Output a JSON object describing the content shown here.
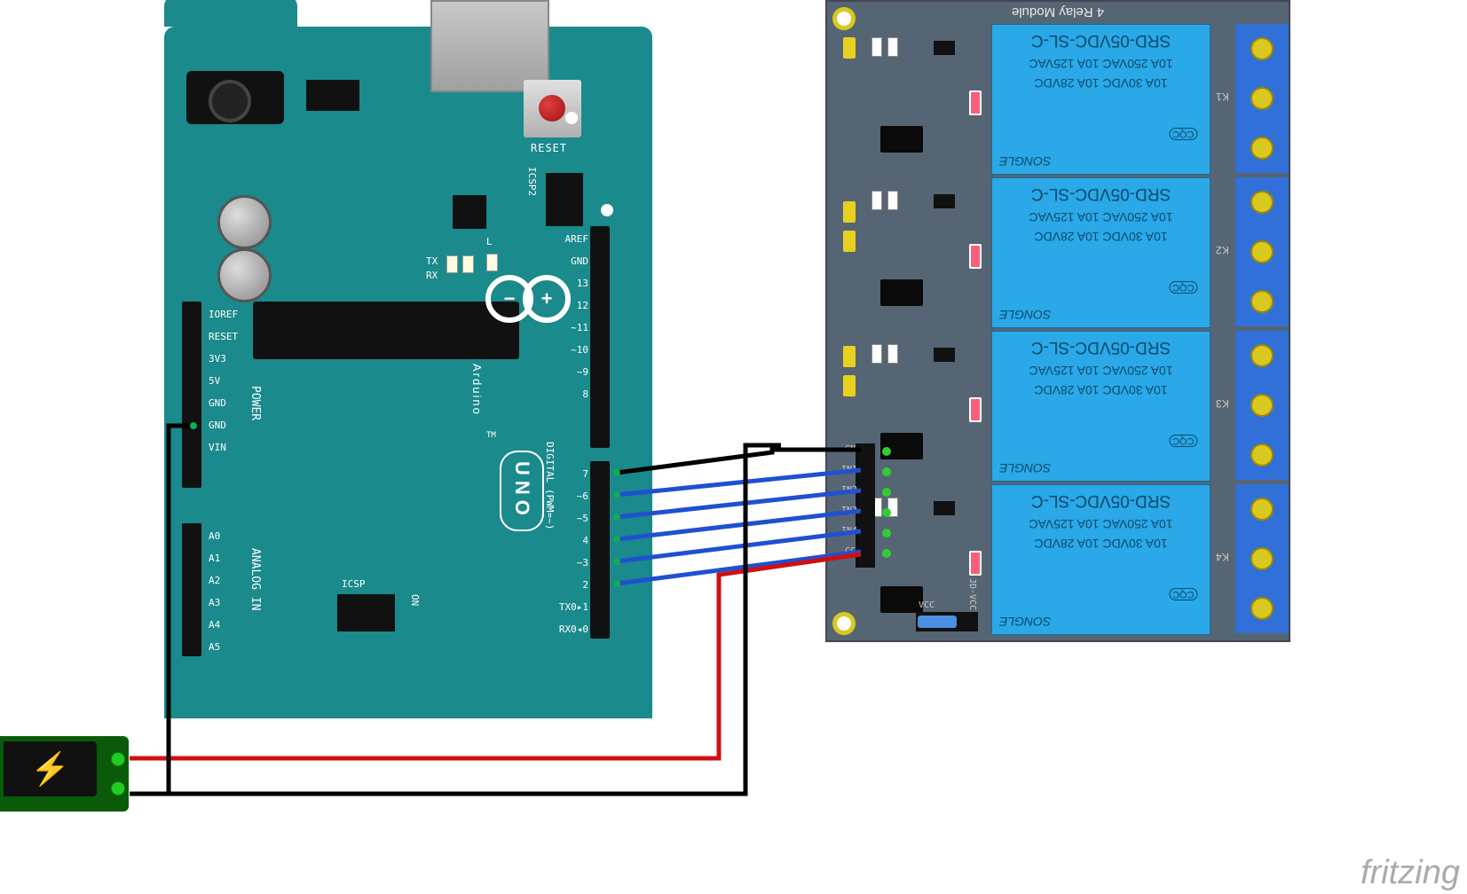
{
  "watermark": "fritzing",
  "arduino": {
    "reset_label": "RESET",
    "pins_left_power": [
      "IOREF",
      "RESET",
      "3V3",
      "5V",
      "GND",
      "GND",
      "VIN"
    ],
    "pins_left_analog": [
      "A0",
      "A1",
      "A2",
      "A3",
      "A4",
      "A5"
    ],
    "pins_right_top": [
      "AREF",
      "GND",
      "13",
      "12",
      "~11",
      "~10",
      "~9",
      "8"
    ],
    "pins_right_bottom": [
      "7",
      "~6",
      "~5",
      "4",
      "~3",
      "2",
      "TX0▸1",
      "RX0◂0"
    ],
    "power_section_label": "POWER",
    "analog_section_label": "ANALOG IN",
    "digital_section_label": "DIGITAL (PWM=~)",
    "icsp_label": "ICSP",
    "icsp2_label": "ICSP2",
    "on_label": "ON",
    "tx_label": "TX",
    "rx_label": "RX",
    "l_label": "L",
    "brand": "Arduino",
    "tm": "TM",
    "model": "UNO"
  },
  "relay": {
    "title": "4 Relay Module",
    "model": "SRD-05VDC-SL-C",
    "rating1": "10A 250VAC 10A 125VAC",
    "rating2": "10A  30VDC 10A  28VDC",
    "brand": "SONGLE",
    "cqc": "CQC",
    "terminals": [
      "K1",
      "K2",
      "K3",
      "K4"
    ],
    "input_pins": [
      "GN",
      "IN1",
      "IN2",
      "IN3",
      "IN4",
      "CC"
    ],
    "vcc_label": "VCC",
    "jdvcc_label": "JD-VCC"
  },
  "power": {
    "icon": "⚡"
  },
  "wires": {
    "signal_color": "#2050d0",
    "gnd_color": "#000000",
    "vcc_color": "#d01010",
    "connections": [
      {
        "from": "arduino-pin-6",
        "to": "relay-GND",
        "color": "gnd"
      },
      {
        "from": "arduino-pin-5",
        "to": "relay-IN1",
        "color": "signal"
      },
      {
        "from": "arduino-pin-4",
        "to": "relay-IN2",
        "color": "signal"
      },
      {
        "from": "arduino-pin-3",
        "to": "relay-IN3",
        "color": "signal"
      },
      {
        "from": "arduino-pin-2",
        "to": "relay-IN4",
        "color": "signal"
      },
      {
        "from": "adapter-pos",
        "to": "relay-VCC",
        "color": "vcc"
      },
      {
        "from": "adapter-neg",
        "to": "arduino-GND",
        "color": "gnd"
      },
      {
        "from": "adapter-neg-branch",
        "to": "relay-GND",
        "color": "gnd"
      }
    ]
  }
}
